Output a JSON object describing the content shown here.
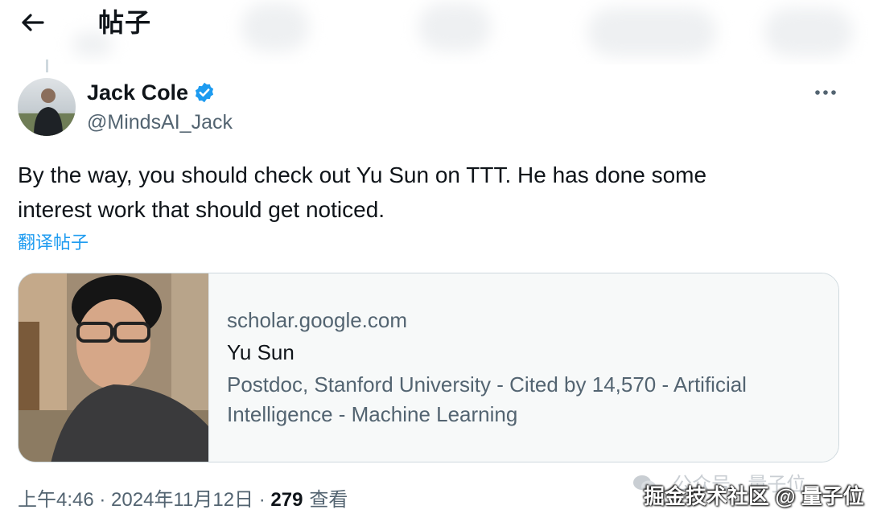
{
  "header": {
    "title": "帖子",
    "back_icon": "arrow-left-icon"
  },
  "author": {
    "display_name": "Jack Cole",
    "handle": "@MindsAI_Jack",
    "verified_badge_color": "#1d9bf0"
  },
  "tweet": {
    "text_line1": "By the way, you should check out Yu Sun on TTT.  He has done some",
    "text_line2": "interest work that should get noticed.",
    "translate_label": "翻译帖子"
  },
  "card": {
    "domain": "scholar.google.com",
    "title": "Yu Sun",
    "description_line1": "Postdoc, Stanford University - Cited by 14,570 - Artificial",
    "description_line2": "Intelligence - Machine Learning"
  },
  "meta": {
    "time": "上午4:46",
    "separator1": " · ",
    "date": "2024年11月12日",
    "separator2": " · ",
    "views_count": "279",
    "views_label": "查看"
  },
  "watermark": {
    "faint_text": "公众号 · 量子位",
    "main_text": "掘金技术社区 @ 量子位"
  },
  "colors": {
    "accent": "#1d9bf0",
    "text_primary": "#0f1419",
    "text_secondary": "#536471",
    "border": "#cfd9de"
  }
}
